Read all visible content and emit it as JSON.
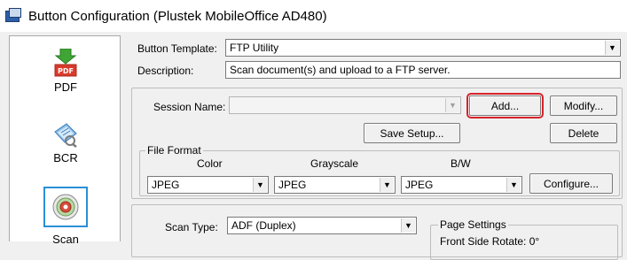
{
  "window": {
    "title": "Button Configuration (Plustek MobileOffice AD480)"
  },
  "sidebar": {
    "items": [
      {
        "label": "PDF",
        "icon": "pdf-download-icon"
      },
      {
        "label": "BCR",
        "icon": "business-card-icon"
      },
      {
        "label": "Scan",
        "icon": "scan-disc-icon",
        "selected": true
      }
    ]
  },
  "template": {
    "label": "Button Template:",
    "value": "FTP Utility",
    "description_label": "Description:",
    "description_value": "Scan document(s) and upload to a FTP server."
  },
  "session": {
    "label": "Session Name:",
    "value": "",
    "add_label": "Add...",
    "modify_label": "Modify...",
    "save_setup_label": "Save Setup...",
    "delete_label": "Delete"
  },
  "file_format": {
    "title": "File Format",
    "color_label": "Color",
    "color_value": "JPEG",
    "grayscale_label": "Grayscale",
    "grayscale_value": "JPEG",
    "bw_label": "B/W",
    "bw_value": "JPEG",
    "configure_label": "Configure..."
  },
  "scan": {
    "type_label": "Scan Type:",
    "type_value": "ADF (Duplex)",
    "page_settings_title": "Page Settings",
    "front_rotate_label": "Front Side Rotate: 0°"
  },
  "colors": {
    "highlight_red": "#d8232a",
    "highlight_blue": "#2b8fd6"
  }
}
